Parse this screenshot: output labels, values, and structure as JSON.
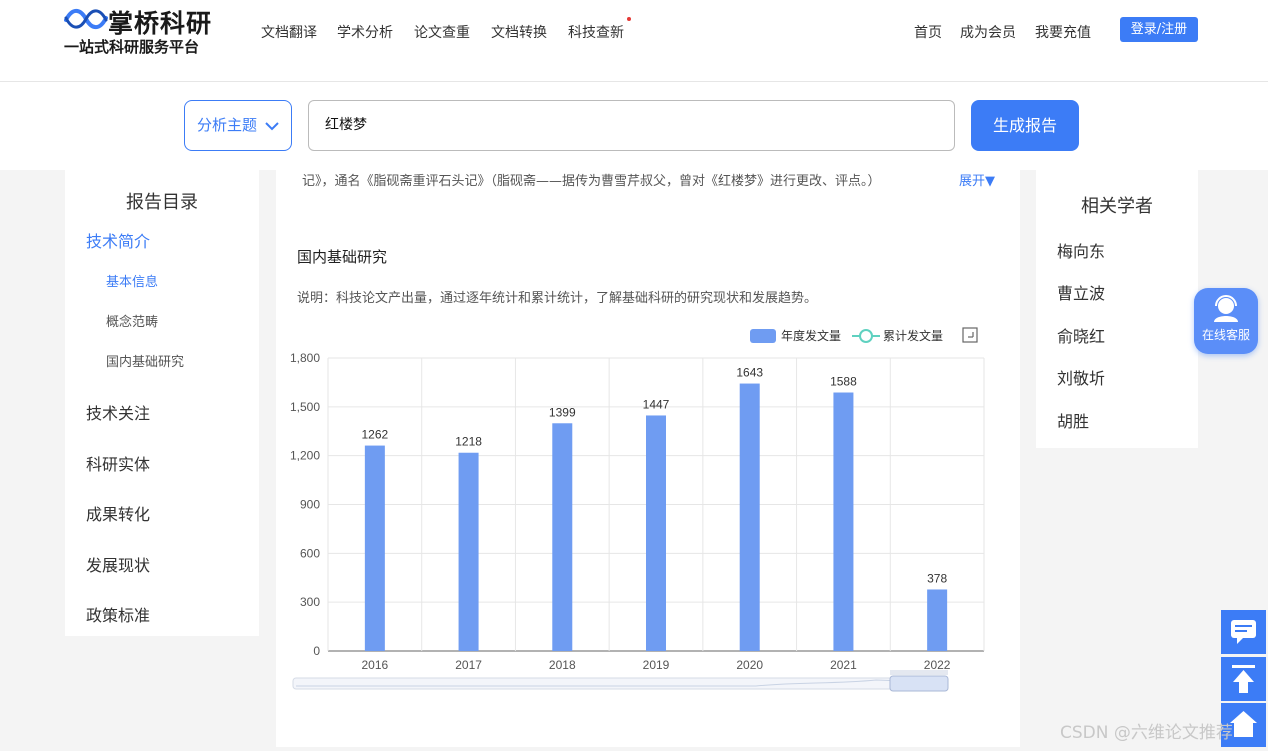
{
  "header": {
    "logo_title": "掌桥科研",
    "logo_subtitle": "一站式科研服务平台",
    "nav": [
      "文档翻译",
      "学术分析",
      "论文查重",
      "文档转换",
      "科技查新"
    ],
    "right_links": [
      "首页",
      "成为会员",
      "我要充值"
    ],
    "login_label": "登录/注册"
  },
  "search": {
    "topic_label": "分析主题",
    "query": "红楼梦",
    "generate_label": "生成报告"
  },
  "toc": {
    "title": "报告目录",
    "items": [
      {
        "label": "技术简介"
      },
      {
        "label": "基本信息"
      },
      {
        "label": "概念范畴"
      },
      {
        "label": "国内基础研究"
      },
      {
        "label": "技术关注"
      },
      {
        "label": "科研实体"
      },
      {
        "label": "成果转化"
      },
      {
        "label": "发展现状"
      },
      {
        "label": "政策标准"
      }
    ]
  },
  "content": {
    "intro_text": "记》，通名《脂砚斋重评石头记》（脂砚斋——据传为曹雪芹叔父，曾对《红楼梦》进行更改、评点。）",
    "expand_label": "展开▼",
    "section_title": "国内基础研究",
    "section_desc": "说明：科技论文产出量，通过逐年统计和累计统计，了解基础科研的研究现状和发展趋势。"
  },
  "chart_data": {
    "type": "bar",
    "categories": [
      "2016",
      "2017",
      "2018",
      "2019",
      "2020",
      "2021",
      "2022"
    ],
    "series": [
      {
        "name": "年度发文量",
        "values": [
          1262,
          1218,
          1399,
          1447,
          1643,
          1588,
          378
        ]
      }
    ],
    "legend": [
      "年度发文量",
      "累计发文量"
    ],
    "y_ticks": [
      "0",
      "300",
      "600",
      "900",
      "1,200",
      "1,500",
      "1,800"
    ],
    "ylim": [
      0,
      1800
    ],
    "grid": true,
    "legend_position": "top-right",
    "bar_color": "#6f9cf2",
    "line_legend_color": "#5fd1c0"
  },
  "scholars": {
    "title": "相关学者",
    "items": [
      "梅向东",
      "曹立波",
      "俞晓红",
      "刘敬圻",
      "胡胜"
    ]
  },
  "service": {
    "label": "在线客服"
  },
  "watermark": "CSDN @六维论文推荐",
  "colors": {
    "accent": "#3c7cf6"
  }
}
